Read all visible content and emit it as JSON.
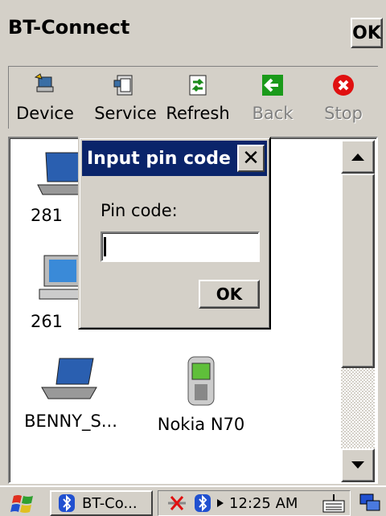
{
  "app": {
    "title": "BT-Connect",
    "ok_label": "OK"
  },
  "toolbar": {
    "buttons": [
      {
        "label": "Device",
        "icon": "device-icon",
        "enabled": true
      },
      {
        "label": "Service",
        "icon": "service-icon",
        "enabled": true
      },
      {
        "label": "Refresh",
        "icon": "refresh-icon",
        "enabled": true
      },
      {
        "label": "Back",
        "icon": "back-arrow-icon",
        "enabled": false
      },
      {
        "label": "Stop",
        "icon": "stop-icon",
        "enabled": false
      }
    ]
  },
  "devices": [
    {
      "label": "281",
      "icon": "laptop-icon"
    },
    {
      "label": "261",
      "icon": "desktop-pc-icon"
    },
    {
      "label": "BENNY_S...",
      "icon": "laptop-icon"
    },
    {
      "label": "Nokia N70",
      "icon": "phone-icon"
    }
  ],
  "dialog": {
    "title": "Input pin code",
    "close_label": "✕",
    "field_label": "Pin code:",
    "pin_value": "",
    "ok_label": "OK"
  },
  "taskbar": {
    "task_label": "BT-Co...",
    "clock": "12:25 AM"
  },
  "colors": {
    "dialog_titlebar": "#0a246a",
    "chrome": "#d4d0c8"
  }
}
